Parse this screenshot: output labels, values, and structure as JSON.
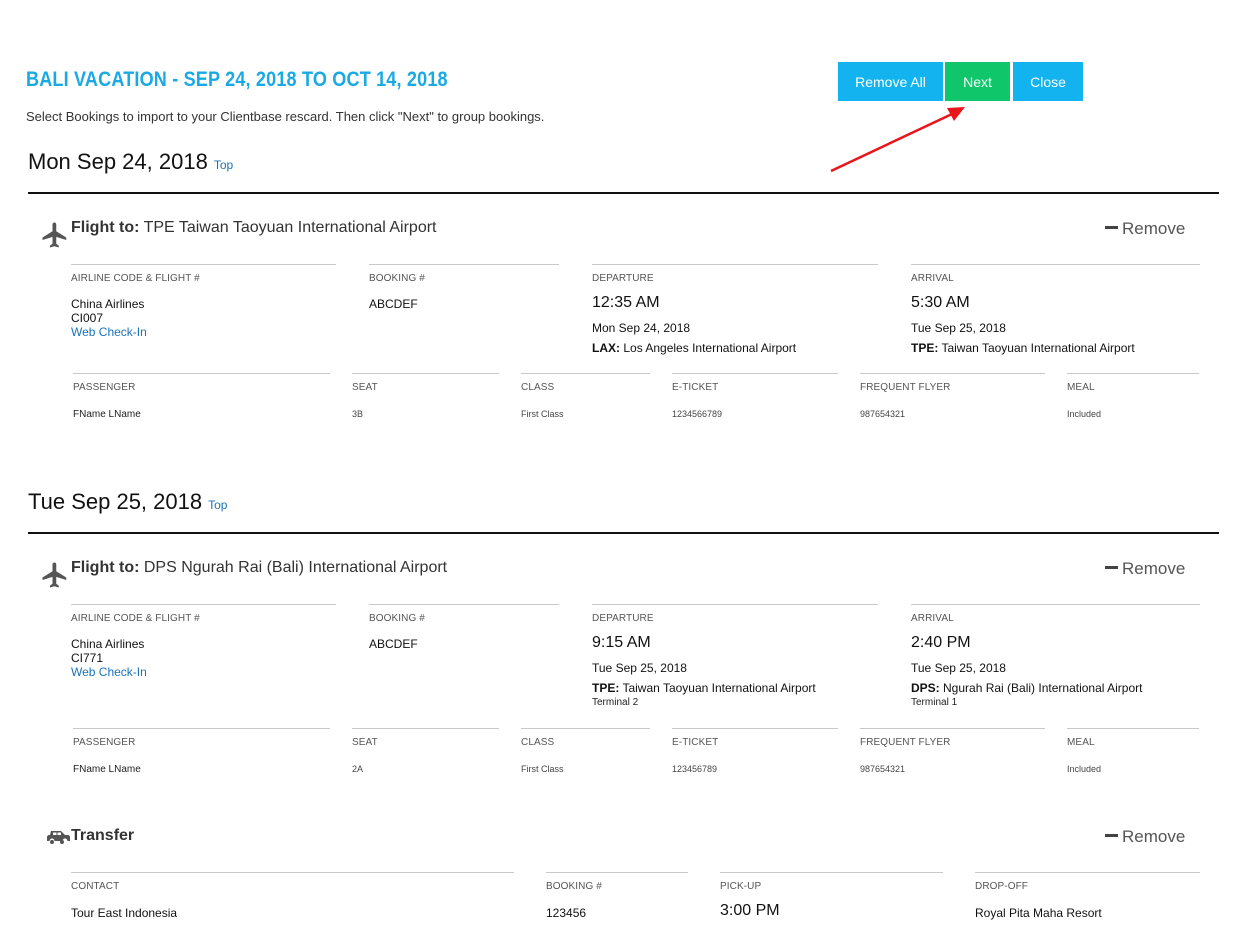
{
  "header": {
    "title": "BALI VACATION - SEP 24, 2018 TO OCT 14, 2018",
    "subtitle": "Select Bookings to import to your Clientbase rescard. Then click \"Next\" to group bookings."
  },
  "buttons": {
    "remove_all": "Remove All",
    "next": "Next",
    "close": "Close"
  },
  "colors": {
    "title": "#1ba9e4",
    "button_blue": "#12b3ee",
    "button_green": "#0fc66a",
    "arrow": "#e8151b",
    "link": "#1a73b8"
  },
  "common": {
    "top_link": "Top",
    "remove": "Remove",
    "flight_to": "Flight to:",
    "labels": {
      "airline": "AIRLINE CODE & FLIGHT #",
      "booking": "BOOKING #",
      "departure": "DEPARTURE",
      "arrival": "ARRIVAL",
      "passenger": "PASSENGER",
      "seat": "SEAT",
      "class": "CLASS",
      "eticket": "E-TICKET",
      "ff": "FREQUENT FLYER",
      "meal": "MEAL",
      "contact": "CONTACT",
      "booking_no": "BOOKING #",
      "pickup": "PICK-UP",
      "dropoff": "DROP-OFF"
    }
  },
  "days": [
    {
      "heading": "Mon Sep 24, 2018",
      "flight": {
        "icon": "airplane-icon",
        "destination": "TPE Taiwan Taoyuan International Airport",
        "airline": "China Airlines",
        "flight_no": "CI007",
        "web_checkin": "Web Check-In",
        "booking": "ABCDEF",
        "dep_time": "12:35 AM",
        "dep_date": "Mon Sep 24, 2018",
        "dep_code": "LAX:",
        "dep_airport": "Los Angeles International Airport",
        "arr_time": "5:30 AM",
        "arr_date": "Tue Sep 25, 2018",
        "arr_code": "TPE:",
        "arr_airport": "Taiwan Taoyuan International Airport",
        "passenger": "FName LName",
        "seat": "3B",
        "class": "First Class",
        "eticket": "1234566789",
        "ff": "987654321",
        "meal": "Included"
      }
    },
    {
      "heading": "Tue Sep 25, 2018",
      "flight": {
        "icon": "airplane-icon",
        "destination": "DPS Ngurah Rai (Bali) International Airport",
        "airline": "China Airlines",
        "flight_no": "CI771",
        "web_checkin": "Web Check-In",
        "booking": "ABCDEF",
        "dep_time": "9:15 AM",
        "dep_date": "Tue Sep 25, 2018",
        "dep_code": "TPE:",
        "dep_airport": "Taiwan Taoyuan International Airport",
        "dep_terminal": "Terminal 2",
        "arr_time": "2:40 PM",
        "arr_date": "Tue Sep 25, 2018",
        "arr_code": "DPS:",
        "arr_airport": "Ngurah Rai (Bali) International Airport",
        "arr_terminal": "Terminal 1",
        "passenger": "FName LName",
        "seat": "2A",
        "class": "First Class",
        "eticket": "123456789",
        "ff": "987654321",
        "meal": "Included"
      },
      "transfer": {
        "icon": "car-icon",
        "title": "Transfer",
        "contact": "Tour East Indonesia",
        "booking": "123456",
        "pickup": "3:00 PM",
        "dropoff": "Royal Pita Maha Resort"
      }
    }
  ]
}
